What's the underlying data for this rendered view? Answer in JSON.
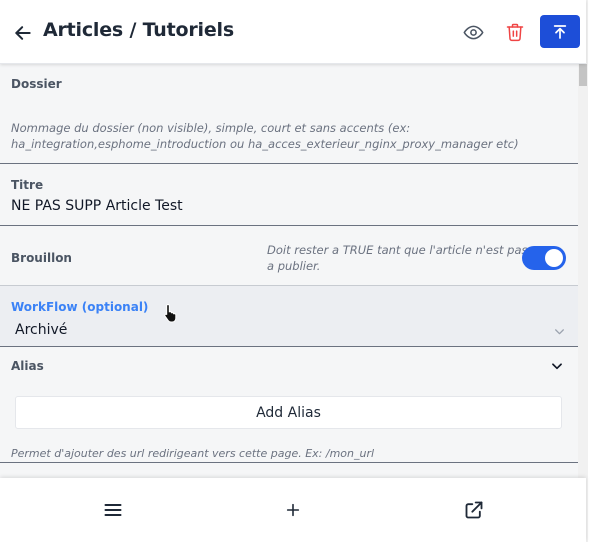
{
  "header": {
    "title": "Articles / Tutoriels",
    "back_icon": "arrow-left-icon",
    "preview_icon": "eye-icon",
    "delete_icon": "trash-icon",
    "publish_icon": "upload-icon"
  },
  "form": {
    "dossier": {
      "label": "Dossier",
      "hint_line1": "Nommage du dossier (non visible), simple, court et sans accents (ex:",
      "hint_line2": "ha_integration,esphome_introduction ou ha_acces_exterieur_nginx_proxy_manager etc)"
    },
    "titre": {
      "label": "Titre",
      "value": "NE PAS SUPP Article Test"
    },
    "brouillon": {
      "label": "Brouillon",
      "hint_line1": "Doit rester a TRUE tant que l'article n'est pas",
      "hint_line2": "a publier.",
      "checked": true
    },
    "workflow": {
      "label": "WorkFlow (optional)",
      "value": "Archivé"
    },
    "alias": {
      "label": "Alias",
      "add_button": "Add Alias",
      "hint": "Permet d'ajouter des url redirigeant vers cette page. Ex: /mon_url"
    }
  },
  "bottom_bar": {
    "menu_icon": "menu-icon",
    "add_icon": "plus-icon",
    "open_icon": "external-link-icon"
  },
  "colors": {
    "accent": "#1d4ed8",
    "toggle": "#2563eb",
    "delete": "#ef4444",
    "label_blue": "#3b82f6"
  }
}
